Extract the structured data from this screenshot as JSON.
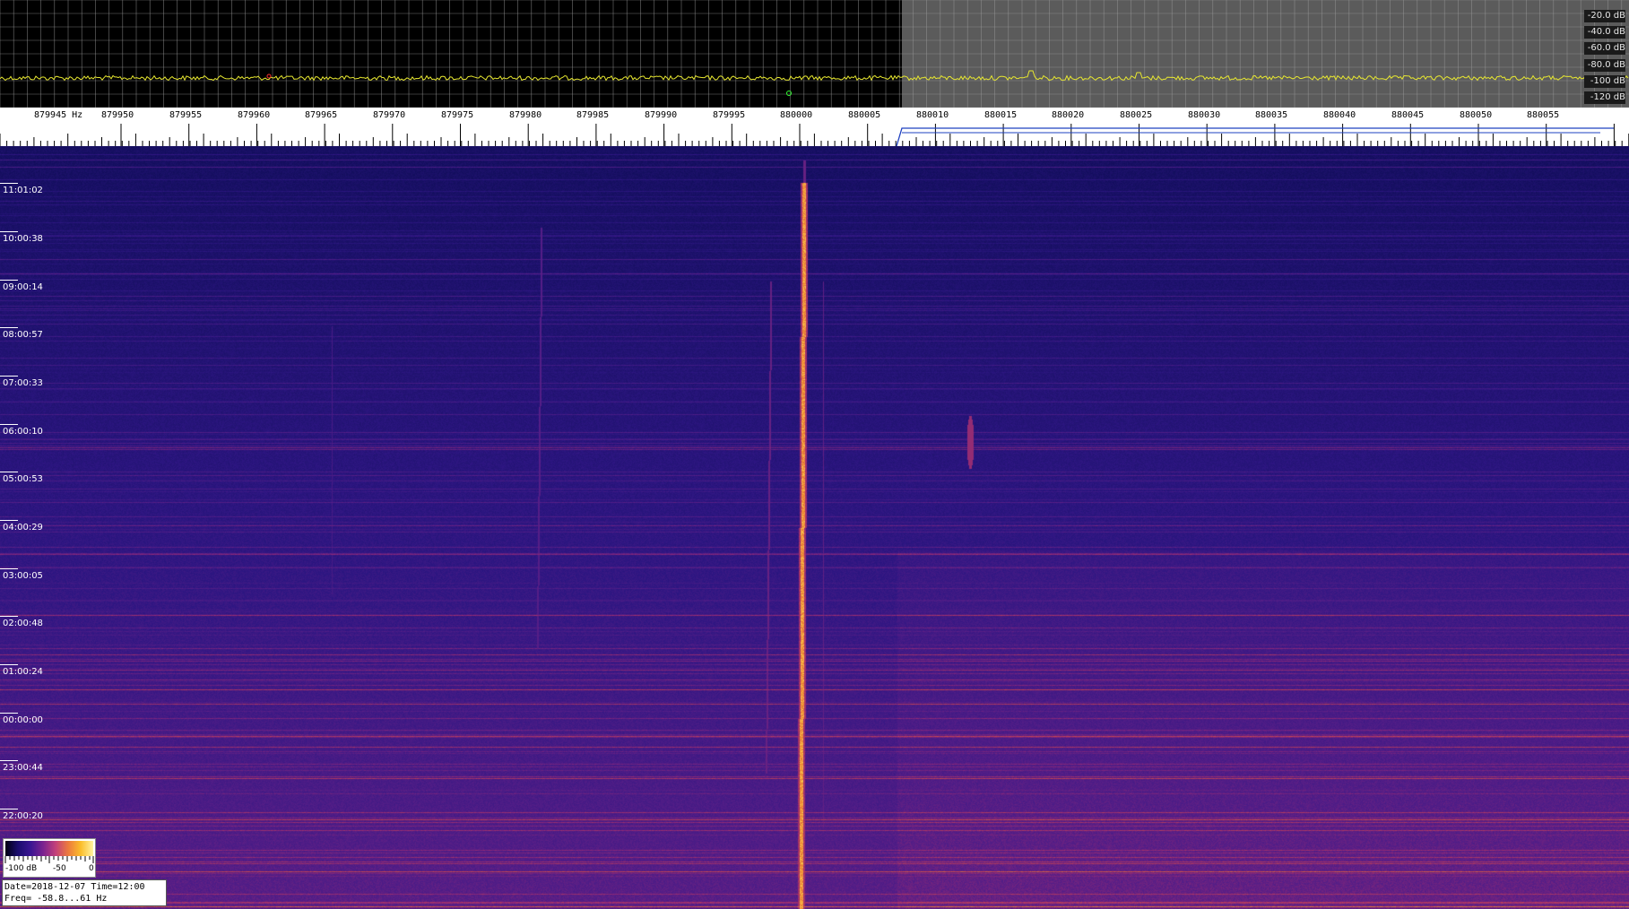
{
  "spectrum": {
    "db_labels": [
      "-20.0 dB",
      "-40.0 dB",
      "-60.0 dB",
      "-80.0 dB",
      "-100 dB",
      "-120 dB"
    ],
    "trace_color": "#e8e830",
    "marker_red_color": "#ff3030",
    "marker_green_color": "#30ff30"
  },
  "freq_scale": {
    "labels": [
      "879945 Hz",
      "879950",
      "879955",
      "879960",
      "879965",
      "879970",
      "879975",
      "879980",
      "879985",
      "879990",
      "879995",
      "880000",
      "880005",
      "880010",
      "880015",
      "880020",
      "880025",
      "880030",
      "880035",
      "880040",
      "880045",
      "880050",
      "880055"
    ],
    "bracket_color": "#1e40c0"
  },
  "waterfall": {
    "time_labels": [
      "11:01:02",
      "10:00:38",
      "09:00:14",
      "08:00:57",
      "07:00:33",
      "06:00:10",
      "05:00:53",
      "04:00:29",
      "03:00:05",
      "02:00:48",
      "01:00:24",
      "00:00:00",
      "23:00:44",
      "22:00:20"
    ]
  },
  "colorbar": {
    "labels": [
      "-100 dB",
      "-50",
      "0"
    ]
  },
  "info": {
    "line1": "Date=2018-12-07 Time=12:00",
    "line2": "Freq= -58.8...61 Hz"
  }
}
